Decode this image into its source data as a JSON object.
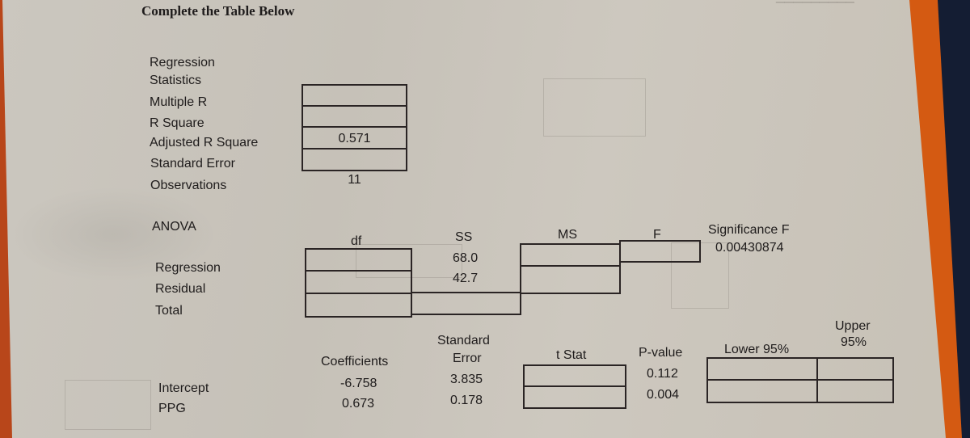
{
  "document": {
    "title": "Complete the Table Below"
  },
  "regression_statistics": {
    "header_line1": "Regression",
    "header_line2": "Statistics",
    "rows": [
      {
        "label": "Multiple R",
        "value": ""
      },
      {
        "label": "R Square",
        "value": ""
      },
      {
        "label": "Adjusted R Square",
        "value": "0.571"
      },
      {
        "label": "Standard Error",
        "value": ""
      },
      {
        "label": "Observations",
        "value": "11"
      }
    ]
  },
  "anova": {
    "heading": "ANOVA",
    "columns": [
      "df",
      "SS",
      "MS",
      "F",
      "Significance F"
    ],
    "rows": [
      {
        "label": "Regression",
        "df": "",
        "ss": "68.0",
        "ms": "",
        "f": "",
        "significance_f": "0.00430874"
      },
      {
        "label": "Residual",
        "df": "",
        "ss": "42.7",
        "ms": ""
      },
      {
        "label": "Total",
        "df": "",
        "ss": ""
      }
    ]
  },
  "coefficients": {
    "columns": {
      "coefficients": "Coefficients",
      "standard_error_line1": "Standard",
      "standard_error_line2": "Error",
      "t_stat": "t Stat",
      "p_value": "P-value",
      "lower_95": "Lower 95%",
      "upper_95_line1": "Upper",
      "upper_95_line2": "95%"
    },
    "rows": [
      {
        "label": "Intercept",
        "coefficient": "-6.758",
        "standard_error": "3.835",
        "t_stat": "",
        "p_value": "0.112",
        "lower_95": "",
        "upper_95": ""
      },
      {
        "label": "PPG",
        "coefficient": "0.673",
        "standard_error": "0.178",
        "t_stat": "",
        "p_value": "0.004",
        "lower_95": "",
        "upper_95": ""
      }
    ]
  }
}
